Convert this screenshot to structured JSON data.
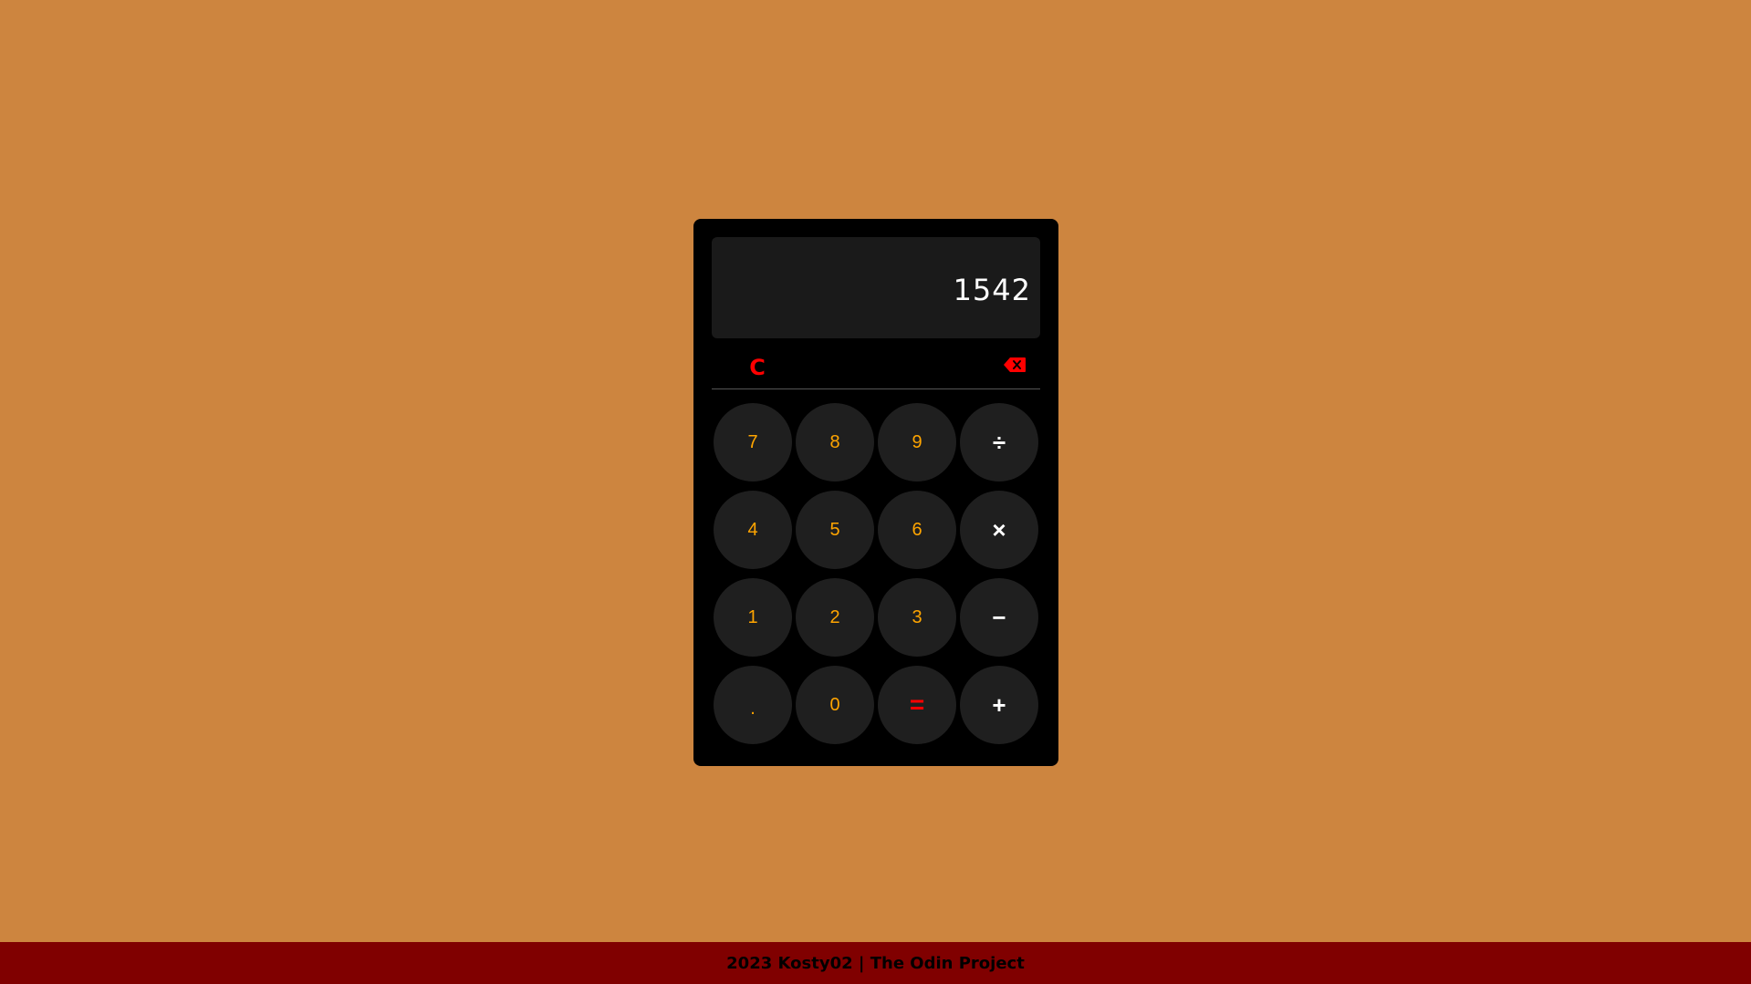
{
  "colors": {
    "page_background": "#CD853F",
    "calculator_body": "#000000",
    "display_background": "#1A1A1A",
    "key_background": "#1F1F1F",
    "digit_color": "#FFA500",
    "operator_color": "#FFFFFF",
    "accent_red": "#FF0000",
    "footer_background": "#800000"
  },
  "display": {
    "value": "1542"
  },
  "controls": {
    "clear_label": "C",
    "backspace_icon": "backspace-icon"
  },
  "keys": [
    {
      "label": "7",
      "kind": "digit"
    },
    {
      "label": "8",
      "kind": "digit"
    },
    {
      "label": "9",
      "kind": "digit"
    },
    {
      "label": "÷",
      "kind": "operator"
    },
    {
      "label": "4",
      "kind": "digit"
    },
    {
      "label": "5",
      "kind": "digit"
    },
    {
      "label": "6",
      "kind": "digit"
    },
    {
      "label": "×",
      "kind": "operator"
    },
    {
      "label": "1",
      "kind": "digit"
    },
    {
      "label": "2",
      "kind": "digit"
    },
    {
      "label": "3",
      "kind": "digit"
    },
    {
      "label": "−",
      "kind": "operator"
    },
    {
      "label": ".",
      "kind": "decimal"
    },
    {
      "label": "0",
      "kind": "digit"
    },
    {
      "label": "=",
      "kind": "equals"
    },
    {
      "label": "+",
      "kind": "operator"
    }
  ],
  "footer": {
    "text": "2023 Kosty02 | The Odin Project"
  }
}
